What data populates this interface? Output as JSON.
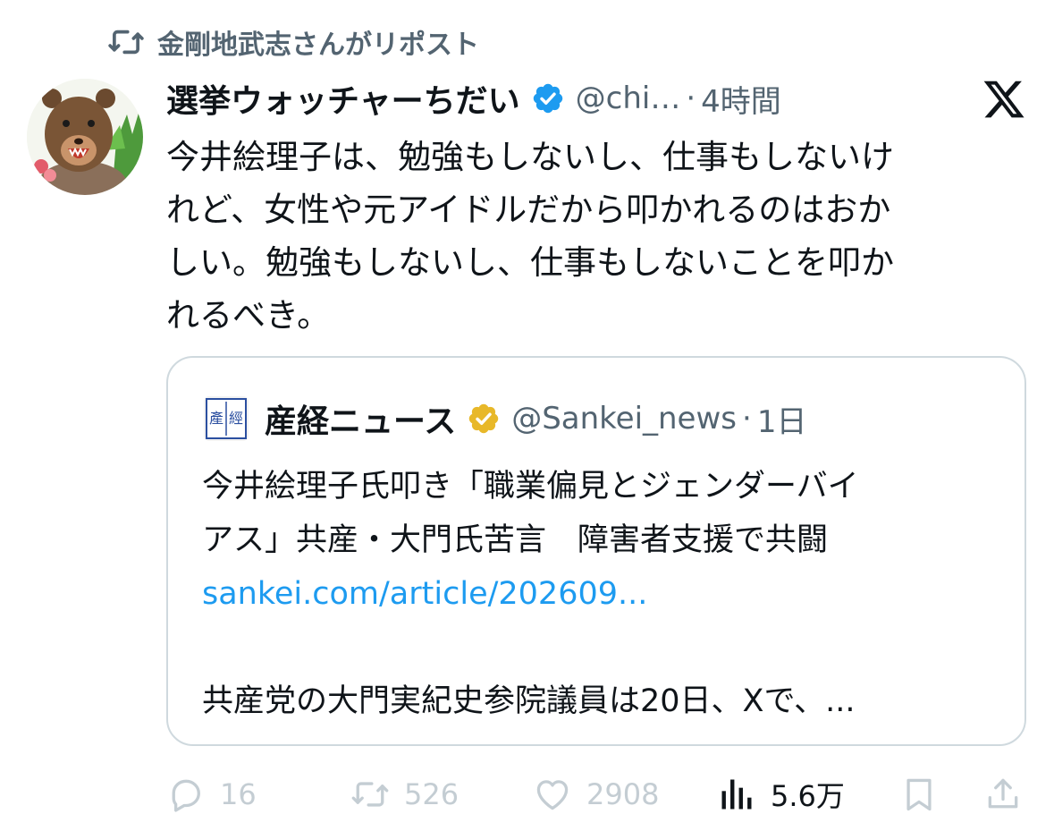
{
  "repost": {
    "icon": "repost-icon",
    "label": "金剛地武志さんがリポスト"
  },
  "tweet": {
    "display_name": "選挙ウォッチャーちだい",
    "handle": "@chi…",
    "separator": "·",
    "time": "4時間",
    "text": "今井絵理子は、勉強もしないし、仕事もしないけ\nれど、女性や元アイドルだから叩かれるのはおか\nしい。勉強もしないし、仕事もしないことを叩か\nれるべき。"
  },
  "quote": {
    "display_name": "産経ニュース",
    "handle": "@Sankei_news",
    "separator": "·",
    "time": "1日",
    "logo_text": "產經",
    "headline": "今井絵理子氏叩き「職業偏見とジェンダーバイ\nアス」共産・大門氏苦言　障害者支援で共闘",
    "link": "sankei.com/article/202609...",
    "excerpt": "共産党の大門実紀史参院議員は20日、Xで、..."
  },
  "actions": {
    "replies": "16",
    "reposts": "526",
    "likes": "2908",
    "views": "5.6万"
  },
  "colors": {
    "verified_blue": "#1d9bf0",
    "verified_gold": "#e8b829",
    "link": "#1d9bf0",
    "muted": "#536471",
    "action_gray": "#c4cdd3"
  }
}
